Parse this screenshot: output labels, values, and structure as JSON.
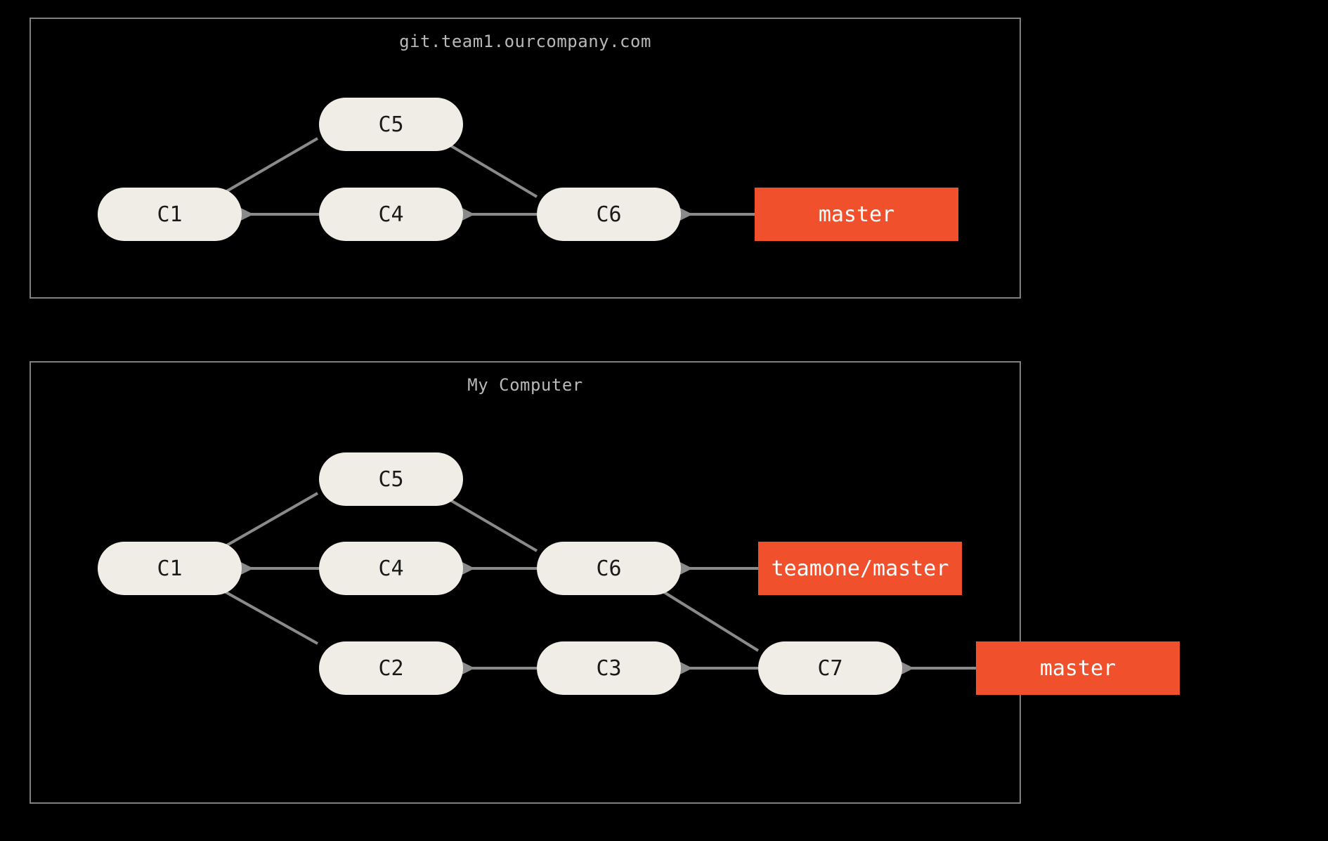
{
  "colors": {
    "background": "#000000",
    "panel_border": "#808080",
    "panel_title": "#b8b8b8",
    "commit_fill": "#efede6",
    "commit_text": "#1a1a1a",
    "branch_fill": "#f0502b",
    "branch_text": "#ffffff",
    "arrow": "#8a8a8a"
  },
  "top_panel": {
    "title": "git.team1.ourcompany.com",
    "commits": {
      "c1": "C1",
      "c4": "C4",
      "c5": "C5",
      "c6": "C6"
    },
    "branches": {
      "master": "master"
    },
    "edges": [
      [
        "C5",
        "C1"
      ],
      [
        "C4",
        "C1"
      ],
      [
        "C6",
        "C5"
      ],
      [
        "C6",
        "C4"
      ],
      [
        "master",
        "C6"
      ]
    ]
  },
  "bottom_panel": {
    "title": "My Computer",
    "commits": {
      "c1": "C1",
      "c2": "C2",
      "c3": "C3",
      "c4": "C4",
      "c5": "C5",
      "c6": "C6",
      "c7": "C7"
    },
    "branches": {
      "teamone_master": "teamone/master",
      "master": "master"
    },
    "edges": [
      [
        "C5",
        "C1"
      ],
      [
        "C4",
        "C1"
      ],
      [
        "C2",
        "C1"
      ],
      [
        "C6",
        "C5"
      ],
      [
        "C6",
        "C4"
      ],
      [
        "C3",
        "C2"
      ],
      [
        "C7",
        "C3"
      ],
      [
        "C7",
        "C6"
      ],
      [
        "teamone/master",
        "C6"
      ],
      [
        "master",
        "C7"
      ]
    ]
  }
}
